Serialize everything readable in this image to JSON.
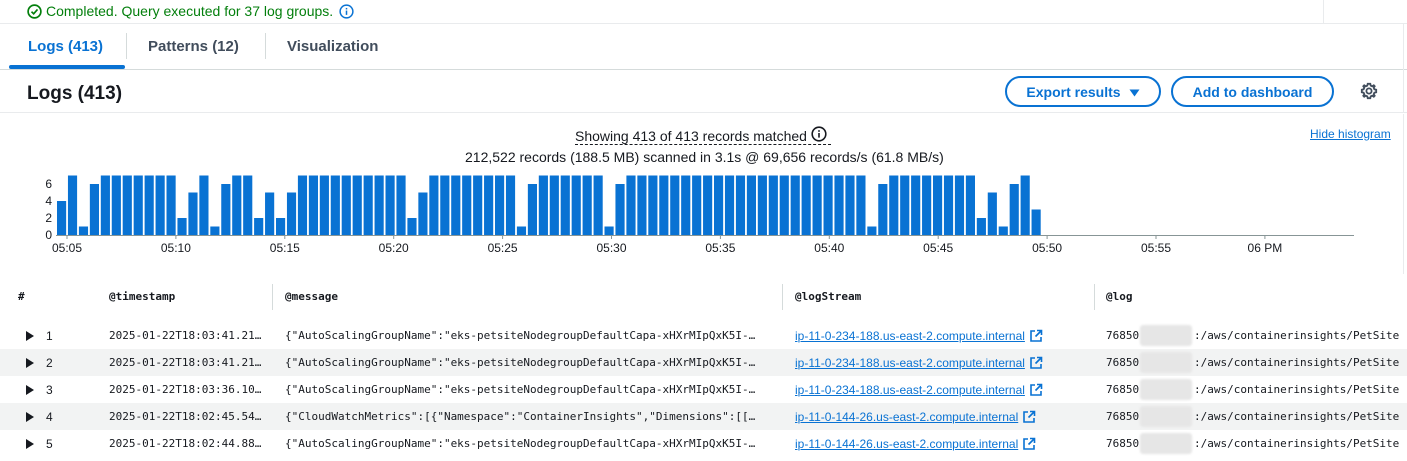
{
  "status": {
    "message": "Completed. Query executed for 37 log groups.",
    "icon": "check-circle-icon",
    "color": "#037f0c"
  },
  "tabs": [
    {
      "label": "Logs (413)",
      "active": true
    },
    {
      "label": "Patterns (12)",
      "active": false
    },
    {
      "label": "Visualization",
      "active": false
    }
  ],
  "header": {
    "title": "Logs (413)",
    "export_label": "Export results",
    "dashboard_label": "Add to dashboard"
  },
  "histogram": {
    "showing": "Showing 413 of 413 records matched",
    "scanned": "212,522 records (188.5 MB) scanned in 3.1s @ 69,656 records/s (61.8 MB/s)",
    "hide_label": "Hide histogram"
  },
  "chart_data": {
    "type": "bar",
    "color": "#0972d3",
    "ylim": [
      0,
      7
    ],
    "y_ticks": [
      "0",
      "2",
      "4",
      "6"
    ],
    "x_ticks": [
      "05:05",
      "05:10",
      "05:15",
      "05:20",
      "05:25",
      "05:30",
      "05:35",
      "05:40",
      "05:45",
      "05:50",
      "05:55",
      "06 PM"
    ],
    "values": [
      4,
      7,
      1,
      6,
      7,
      7,
      7,
      7,
      7,
      7,
      7,
      2,
      5,
      7,
      1,
      6,
      7,
      7,
      2,
      5,
      2,
      5,
      7,
      7,
      7,
      7,
      7,
      7,
      7,
      7,
      7,
      7,
      2,
      5,
      7,
      7,
      7,
      7,
      7,
      7,
      7,
      7,
      1,
      6,
      7,
      7,
      7,
      7,
      7,
      7,
      1,
      6,
      7,
      7,
      7,
      7,
      7,
      7,
      7,
      7,
      7,
      7,
      7,
      7,
      7,
      7,
      7,
      7,
      7,
      7,
      7,
      7,
      7,
      7,
      1,
      6,
      7,
      7,
      7,
      7,
      7,
      7,
      7,
      7,
      2,
      5,
      1,
      6,
      7,
      3
    ]
  },
  "columns": [
    "#",
    "@timestamp",
    "@message",
    "@logStream",
    "@log"
  ],
  "rows": [
    {
      "num": "1",
      "timestamp": "2025-01-22T18:03:41.21…",
      "message": "{\"AutoScalingGroupName\":\"eks-petsiteNodegroupDefaultCapa-xHXrMIpQxK5I-…",
      "logstream": "ip-11-0-234-188.us-east-2.compute.internal",
      "log_prefix": "76850",
      "log_suffix": ":/aws/containerinsights/PetSite"
    },
    {
      "num": "2",
      "timestamp": "2025-01-22T18:03:41.21…",
      "message": "{\"AutoScalingGroupName\":\"eks-petsiteNodegroupDefaultCapa-xHXrMIpQxK5I-…",
      "logstream": "ip-11-0-234-188.us-east-2.compute.internal",
      "log_prefix": "76850",
      "log_suffix": ":/aws/containerinsights/PetSite"
    },
    {
      "num": "3",
      "timestamp": "2025-01-22T18:03:36.10…",
      "message": "{\"AutoScalingGroupName\":\"eks-petsiteNodegroupDefaultCapa-xHXrMIpQxK5I-…",
      "logstream": "ip-11-0-234-188.us-east-2.compute.internal",
      "log_prefix": "76850",
      "log_suffix": ":/aws/containerinsights/PetSite"
    },
    {
      "num": "4",
      "timestamp": "2025-01-22T18:02:45.54…",
      "message": "{\"CloudWatchMetrics\":[{\"Namespace\":\"ContainerInsights\",\"Dimensions\":[[…",
      "logstream": "ip-11-0-144-26.us-east-2.compute.internal",
      "log_prefix": "76850",
      "log_suffix": ":/aws/containerinsights/PetSite"
    },
    {
      "num": "5",
      "timestamp": "2025-01-22T18:02:44.88…",
      "message": "{\"AutoScalingGroupName\":\"eks-petsiteNodegroupDefaultCapa-xHXrMIpQxK5I-…",
      "logstream": "ip-11-0-144-26.us-east-2.compute.internal",
      "log_prefix": "76850",
      "log_suffix": ":/aws/containerinsights/PetSite"
    }
  ]
}
